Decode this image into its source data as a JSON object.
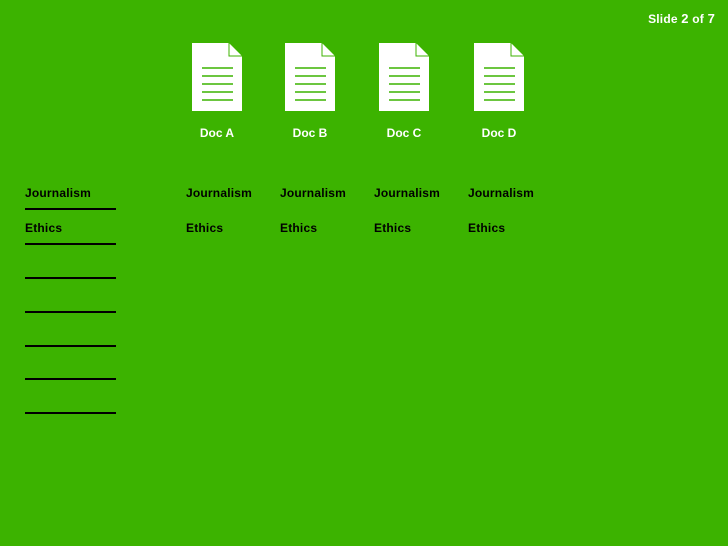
{
  "slide_counter": {
    "prefix": "Slide",
    "current": "2",
    "of": "of",
    "total": "7"
  },
  "documents": [
    {
      "label": "Doc A",
      "icon": "document-icon"
    },
    {
      "label": "Doc B",
      "icon": "document-icon"
    },
    {
      "label": "Doc C",
      "icon": "document-icon"
    },
    {
      "label": "Doc D",
      "icon": "document-icon"
    }
  ],
  "answer_column": {
    "items": [
      "Journalism",
      "Ethics"
    ],
    "blank_count": 7
  },
  "doc_terms": [
    [
      "Journalism",
      "Ethics"
    ],
    [
      "Journalism",
      "Ethics"
    ],
    [
      "Journalism",
      "Ethics"
    ],
    [
      "Journalism",
      "Ethics"
    ]
  ],
  "colors": {
    "background": "#3cb300",
    "doc_line": "#3cb300"
  }
}
